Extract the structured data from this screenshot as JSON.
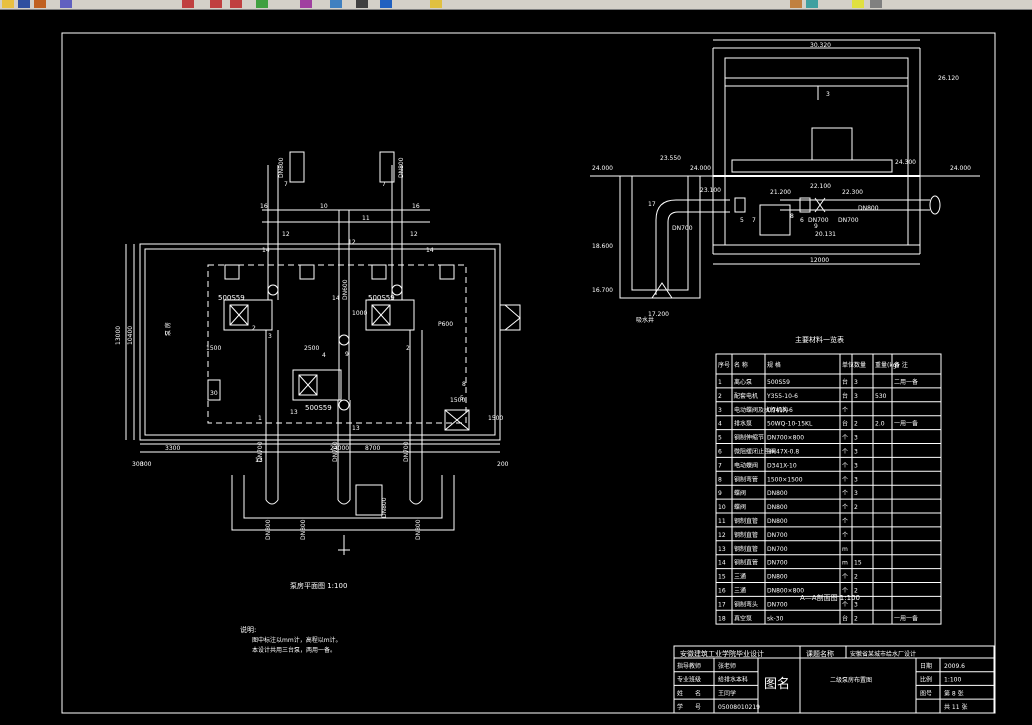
{
  "toolbar": {
    "icons": [
      {
        "name": "open-icon",
        "color": "#e8c040"
      },
      {
        "name": "save-icon",
        "color": "#3050a0"
      },
      {
        "name": "edit-icon",
        "color": "#c06020"
      },
      {
        "name": "undo-icon",
        "color": "#6060c0"
      },
      {
        "name": "zoom-realtime-icon",
        "color": "#c04040"
      },
      {
        "name": "zoom-window-icon",
        "color": "#c04040"
      },
      {
        "name": "zoom-previous-icon",
        "color": "#c04040"
      },
      {
        "name": "properties-icon",
        "color": "#40a040"
      },
      {
        "name": "design-center-icon",
        "color": "#a040a0"
      },
      {
        "name": "tool-palette-icon",
        "color": "#4080c0"
      },
      {
        "name": "calculator-icon",
        "color": "#404040"
      },
      {
        "name": "help-icon",
        "color": "#2060c0"
      },
      {
        "name": "layer-icon",
        "color": "#e0c040"
      },
      {
        "name": "layer-state-icon",
        "color": "#c08040"
      },
      {
        "name": "layer-previous-icon",
        "color": "#40a0a0"
      },
      {
        "name": "color-control-icon",
        "color": "#e0e040"
      },
      {
        "name": "linetype-icon",
        "color": "#808080"
      }
    ]
  },
  "plan": {
    "caption": "泵房平面图 1:100",
    "pump_labels": [
      "500S59",
      "500S59",
      "500S59"
    ],
    "pipe_labels": [
      "DN800",
      "DN800",
      "DN600",
      "DN700",
      "DN700",
      "DN700",
      "DN800",
      "DN800",
      "DN800",
      "DN800"
    ],
    "dims": [
      "24000",
      "3300",
      "8700",
      "300",
      "200",
      "300",
      "13000",
      "10400",
      "1500",
      "2500",
      "1500",
      "1500",
      "1000",
      "P600"
    ],
    "item_numbers": [
      "7",
      "7",
      "16",
      "12",
      "10",
      "11",
      "12",
      "16",
      "14",
      "14",
      "14",
      "2",
      "3",
      "9",
      "2",
      "4",
      "13",
      "1",
      "13",
      "12",
      "8",
      "5",
      "30",
      "13"
    ],
    "side_label": "泵 房"
  },
  "note": {
    "title": "说明:",
    "lines": [
      "图中标注以mm计，高程以m计。",
      "本设计共用三台泵，两用一备。"
    ]
  },
  "section": {
    "caption": "A—A剖面图 1:100",
    "elevations": [
      "30.320",
      "26.120",
      "24.000",
      "24.000",
      "24.000",
      "23.550",
      "24.300",
      "23.100",
      "21.200",
      "22.100",
      "22.300",
      "20.131",
      "18.600",
      "16.700",
      "17.200"
    ],
    "labels": [
      "DN700",
      "DN700",
      "DN700",
      "DN800",
      "12000",
      "3",
      "17",
      "5",
      "7",
      "6",
      "8",
      "9",
      "吸水井"
    ]
  },
  "materials": {
    "title": "主要材料一览表",
    "headers": [
      "序号",
      "名 称",
      "规 格",
      "单位",
      "数量",
      "重量(kg)",
      "备 注"
    ],
    "rows": [
      [
        "1",
        "离心泵",
        "500S59",
        "台",
        "3",
        "",
        "二用一备"
      ],
      [
        "2",
        "配套电机",
        "Y355-10-6",
        "台",
        "3",
        "530",
        ""
      ],
      [
        "3",
        "电动蝶阀及执行机构",
        "D941X-6",
        "个",
        "",
        "",
        ""
      ],
      [
        "4",
        "排水泵",
        "50WQ-10-15KL",
        "台",
        "2",
        "2.0",
        "一用一备"
      ],
      [
        "5",
        "钢制伸缩节",
        "DN700×800",
        "个",
        "3",
        "",
        ""
      ],
      [
        "6",
        "微阻缓闭止回阀",
        "HH47X-0.8",
        "个",
        "3",
        "",
        ""
      ],
      [
        "7",
        "电动蝶阀",
        "D341X-10",
        "个",
        "3",
        "",
        ""
      ],
      [
        "8",
        "钢制弯管",
        "1500×1500",
        "个",
        "3",
        "",
        ""
      ],
      [
        "9",
        "蝶阀",
        "DN800",
        "个",
        "3",
        "",
        ""
      ],
      [
        "10",
        "蝶阀",
        "DN800",
        "个",
        "2",
        "",
        ""
      ],
      [
        "11",
        "钢制直管",
        "DN800",
        "个",
        "",
        "",
        ""
      ],
      [
        "12",
        "钢制直管",
        "DN700",
        "个",
        "",
        "",
        ""
      ],
      [
        "13",
        "钢制直管",
        "DN700",
        "m",
        "",
        "",
        ""
      ],
      [
        "14",
        "钢制直管",
        "DN700",
        "m",
        "15",
        "",
        ""
      ],
      [
        "15",
        "三通",
        "DN800",
        "个",
        "2",
        "",
        ""
      ],
      [
        "16",
        "三通",
        "DN800×800",
        "个",
        "2",
        "",
        ""
      ],
      [
        "17",
        "钢制弯头",
        "DN700",
        "个",
        "3",
        "",
        ""
      ],
      [
        "18",
        "真空泵",
        "sk-30",
        "台",
        "2",
        "",
        "一用一备"
      ]
    ]
  },
  "title_block": {
    "school": "安徽建筑工业学院毕业设计",
    "subject_label": "课题名称",
    "subject": "安徽省某城市给水厂设计",
    "drawing_label": "图名",
    "drawing_name": "二级泵房布置图",
    "rows_left": [
      [
        "指导教师",
        "张老师"
      ],
      [
        "专业班级",
        "给排水本科"
      ],
      [
        "姓　　名",
        "王同学"
      ],
      [
        "学　　号",
        "05008010219"
      ]
    ],
    "rows_right": [
      [
        "日期",
        "2009.6"
      ],
      [
        "比例",
        "1:100"
      ],
      [
        "图号",
        "第 8 张"
      ],
      [
        "",
        "共 11 张"
      ]
    ]
  }
}
